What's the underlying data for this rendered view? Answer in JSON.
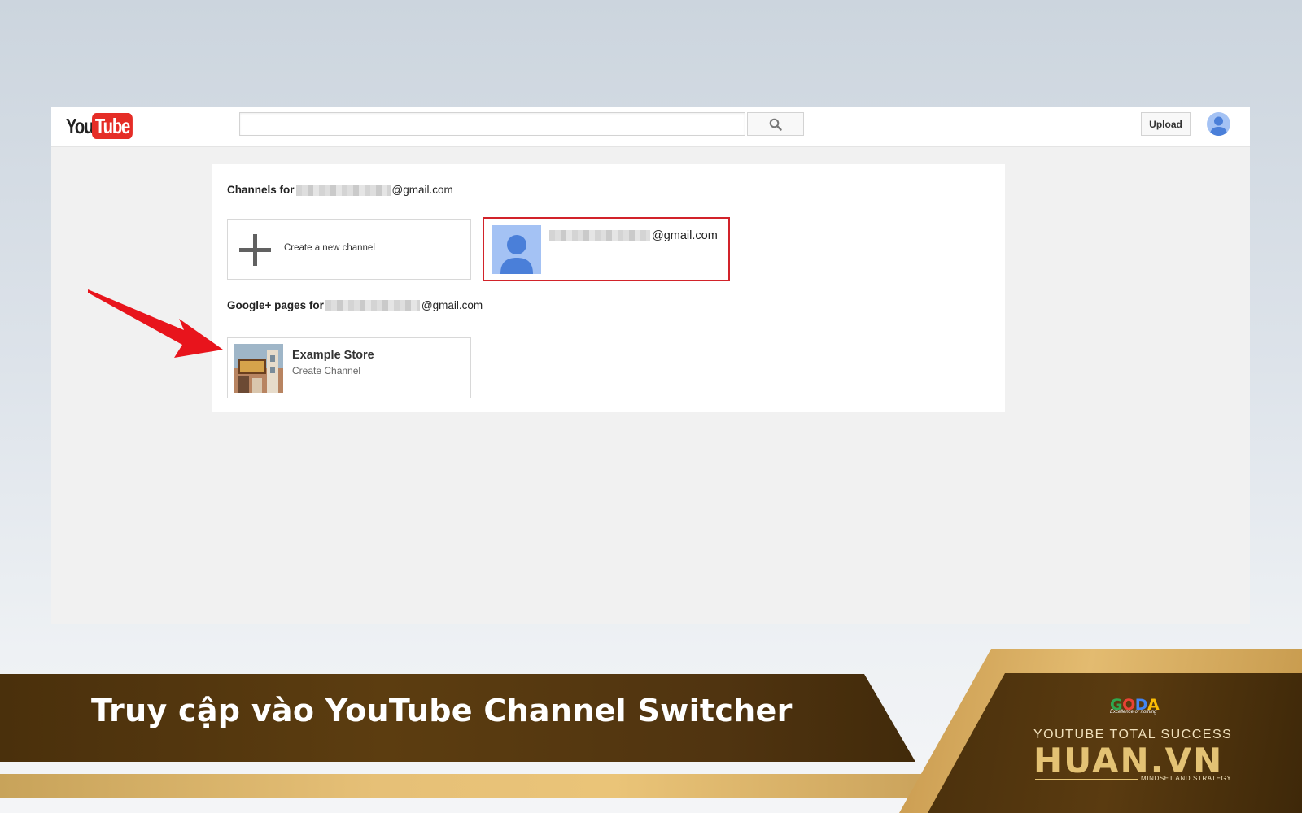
{
  "header": {
    "logo_you": "You",
    "logo_tube": "Tube",
    "search_placeholder": "",
    "upload_label": "Upload"
  },
  "channels": {
    "heading_prefix": "Channels for",
    "heading_suffix": "@gmail.com",
    "create_label": "Create a new channel",
    "account_email_suffix": "@gmail.com"
  },
  "pages": {
    "heading_prefix": "Google+ pages for",
    "heading_suffix": "@gmail.com",
    "store_name": "Example Store",
    "store_action": "Create Channel"
  },
  "banner": {
    "title": "Truy cập vào YouTube Channel Switcher",
    "brand_logo": "GODA",
    "brand_tagline": "Excellence or nothing",
    "course": "YOUTUBE TOTAL SUCCESS",
    "site": "HUAN.VN",
    "slogan": "MINDSET AND STRATEGY"
  },
  "colors": {
    "youtube_red": "#e52d27",
    "highlight_border": "#d2232a",
    "avatar_blue": "#a4c2f4",
    "banner_brown": "#4a300c",
    "banner_gold": "#e3c274"
  }
}
